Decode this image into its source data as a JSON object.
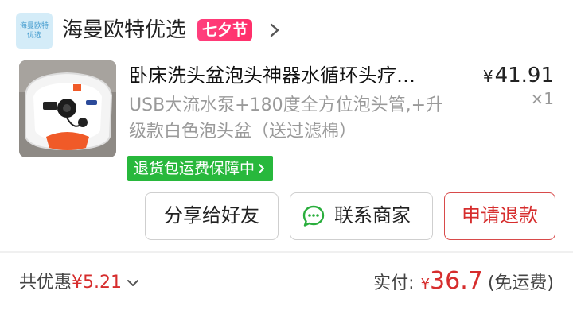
{
  "shop": {
    "logo_line1": "海曼欧特",
    "logo_line2": "优选",
    "name": "海曼欧特优选",
    "festival_badge": "七夕节"
  },
  "product": {
    "title": "卧床洗头盆泡头神器水循环头疗…",
    "price_currency": "¥",
    "price_value": "41.91",
    "quantity": "×1",
    "spec": "USB大流水泵+180度全方位泡头管,+升级款白色泡头盆（送过滤棉）",
    "guarantee": "退货包运费保障中"
  },
  "actions": {
    "share_label": "分享给好友",
    "contact_label": "联系商家",
    "refund_label": "申请退款"
  },
  "summary": {
    "discount_label": "共优惠",
    "discount_amount": "¥5.21",
    "actual_label": "实付:",
    "actual_currency": "¥",
    "actual_amount": "36.7",
    "shipping_note": "(免运费)"
  },
  "colors": {
    "accent_red": "#d62d2d",
    "guarantee_green": "#28b83c",
    "festival_pink": "#ff3f7d"
  }
}
